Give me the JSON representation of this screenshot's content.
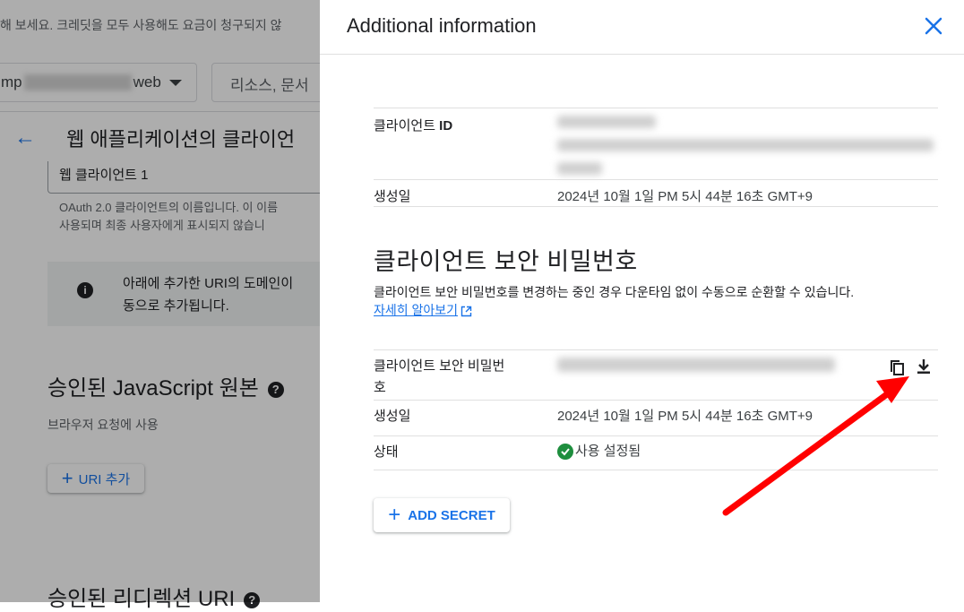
{
  "background": {
    "banner_text": "해 보세요. 크레딧을 모두 사용해도 요금이 청구되지 않",
    "project_prefix": "mp",
    "project_suffix": "web",
    "search_placeholder": "리소스, 문서",
    "back_arrow": "←",
    "page_title": "웹 애플리케이션의 클라이언",
    "client_name_value": "웹 클라이언트 1",
    "client_name_help_line1": "OAuth 2.0 클라이언트의 이름입니다. 이 이름",
    "client_name_help_line2": "사용되며 최종 사용자에게 표시되지 않습니",
    "info_line1": "아래에 추가한 URI의 도메인이",
    "info_line2": "동으로 추가됩니다.",
    "js_origins_heading": "승인된 JavaScript 원본",
    "js_origins_sub": "브라우저 요청에 사용",
    "add_uri_label": "URI 추가",
    "redirect_heading": "승인된 리디렉션 URI"
  },
  "panel": {
    "title": "Additional information",
    "client_id_label_prefix": "클라이언트 ",
    "client_id_label_bold": "ID",
    "created_label": "생성일",
    "created_value": "2024년 10월 1일 PM 5시 44분 16초 GMT+9",
    "secret_section_title": "클라이언트 보안 비밀번호",
    "secret_section_desc": "클라이언트 보안 비밀번호를 변경하는 중인 경우 다운타임 없이 수동으로 순환할 수 있습니다.",
    "learn_more": "자세히 알아보기",
    "secret_label_line1": "클라이언트 보안 비밀번",
    "secret_label_line2": "호",
    "secret_created_label": "생성일",
    "secret_created_value": "2024년 10월 1일 PM 5시 44분 16초 GMT+9",
    "status_label": "상태",
    "status_value": "사용 설정됨",
    "add_secret_label": "ADD SECRET"
  },
  "icons": {
    "close": "close-icon",
    "copy": "copy-icon",
    "download": "download-icon",
    "external_link": "open-in-new-icon",
    "status": "check-circle-icon",
    "info": "info-icon",
    "help": "help-icon"
  },
  "colors": {
    "accent": "#1a73e8",
    "success": "#1e8e3e",
    "annotation_arrow": "#ff0000"
  }
}
